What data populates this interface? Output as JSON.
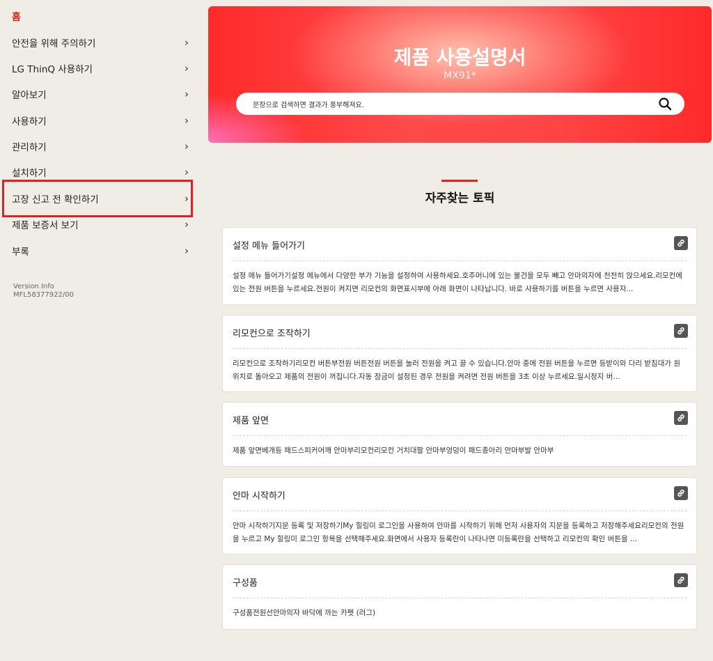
{
  "sidebar": {
    "home": "홈",
    "items": [
      {
        "label": "안전을 위해 주의하기",
        "chevron": "›"
      },
      {
        "label": "LG ThinQ 사용하기",
        "chevron": "›"
      },
      {
        "label": "알아보기",
        "chevron": "›"
      },
      {
        "label": "사용하기",
        "chevron": "›"
      },
      {
        "label": "관리하기",
        "chevron": "›"
      },
      {
        "label": "설치하기",
        "chevron": "›"
      },
      {
        "label": "고장 신고 전 확인하기",
        "chevron": "›"
      },
      {
        "label": "제품 보증서 보기",
        "chevron": "›"
      },
      {
        "label": "부록",
        "chevron": "›"
      }
    ],
    "version_label": "Version Info",
    "version_code": "MFL58377922/00"
  },
  "hero": {
    "title": "제품 사용설명서",
    "model": "MX91*",
    "search_placeholder": "문장으로 검색하면 결과가 풍부해져요."
  },
  "topics": {
    "heading": "자주찾는 토픽",
    "cards": [
      {
        "title": "설정 메뉴 들어가기",
        "body": "설정 메뉴 들어가기설정 메뉴에서 다양한 부가 기능을 설정하여 사용하세요.호주머니에 있는 물건을 모두 빼고 안마의자에 천천히 앉으세요.리모컨에 있는 전원 버튼을 누르세요.전원이 켜지면 리모컨의 화면표시부에 아래 화면이 나타납니다. 바로 사용하기를 버튼을 누르면 사용자..."
      },
      {
        "title": "리모컨으로 조작하기",
        "body": "리모컨으로 조작하기리모컨 버튼부전원 버튼전원 버튼을 눌러 전원을 켜고 끌 수 있습니다.안마 중에 전원 버튼을 누르면 등받이와 다리 받침대가 원 위치로 돌아오고 제품의 전원이 꺼집니다.자동 잠금이 설정된 경우 전원을 켜려면 전원 버튼을 3초 이상 누르세요.일시정지 버..."
      },
      {
        "title": "제품 앞면",
        "body": "제품 앞면베개등 패드스피커어깨 안마부리모컨리모컨 거치대팔 안마부엉덩이 패드종아리 안마부발 안마부"
      },
      {
        "title": "안마 시작하기",
        "body": "안마 시작하기지문 등록 및 저장하기My 힐링미 로그인을 사용하여 안마를 시작하기 위해 먼저 사용자의 지문을 등록하고 저장해주세요리모컨의 전원을 누르고 My 힐링미 로그인 항목을 선택해주세요.화면에서 사용자 등록란이 나타나면 미등록란을 선택하고 리모컨의 확인 버튼을 ..."
      },
      {
        "title": "구성품",
        "body": "구성품전원선안마의자 바닥에 까는 카펫 (러그)"
      }
    ]
  },
  "colors": {
    "accent": "#e2231a",
    "background": "#f0ece6"
  }
}
